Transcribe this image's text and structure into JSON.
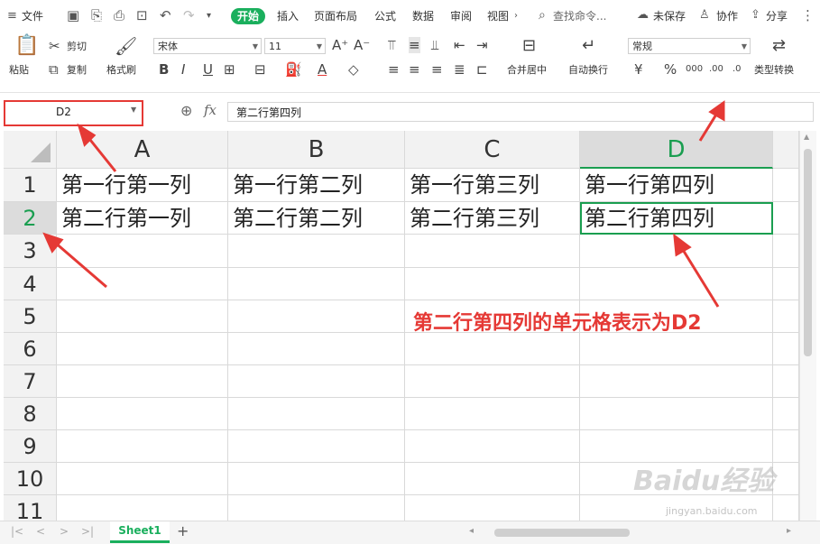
{
  "menubar": {
    "file_label": "文件",
    "tabs": [
      "开始",
      "插入",
      "页面布局",
      "公式",
      "数据",
      "审阅",
      "视图"
    ],
    "search_placeholder": "查找命令...",
    "unsaved_label": "未保存",
    "collab_label": "协作",
    "share_label": "分享"
  },
  "ribbon": {
    "paste_label": "粘贴",
    "cut_label": "剪切",
    "copy_label": "复制",
    "format_painter_label": "格式刷",
    "font_name": "宋体",
    "font_size": "11",
    "merge_label": "合并居中",
    "wrap_label": "自动换行",
    "number_format": "常规",
    "type_convert_label": "类型转换"
  },
  "formula_bar": {
    "name_box": "D2",
    "fx_label": "fx",
    "formula": "第二行第四列"
  },
  "grid": {
    "columns": [
      "A",
      "B",
      "C",
      "D"
    ],
    "rows": [
      "1",
      "2",
      "3",
      "4",
      "5",
      "6",
      "7",
      "8",
      "9",
      "10",
      "11"
    ],
    "cells": [
      [
        "第一行第一列",
        "第一行第二列",
        "第一行第三列",
        "第一行第四列"
      ],
      [
        "第二行第一列",
        "第二行第二列",
        "第二行第三列",
        "第二行第四列"
      ]
    ],
    "selected_column": "D",
    "selected_row": "2"
  },
  "annotation": "第二行第四列的单元格表示为D2",
  "sheets": [
    "Sheet1"
  ],
  "add_sheet_label": "+",
  "watermark": {
    "main": "Baidu经验",
    "sub": "jingyan.baidu.com"
  },
  "colors": {
    "accent": "#1aaf5d",
    "annotation": "#e53935"
  }
}
